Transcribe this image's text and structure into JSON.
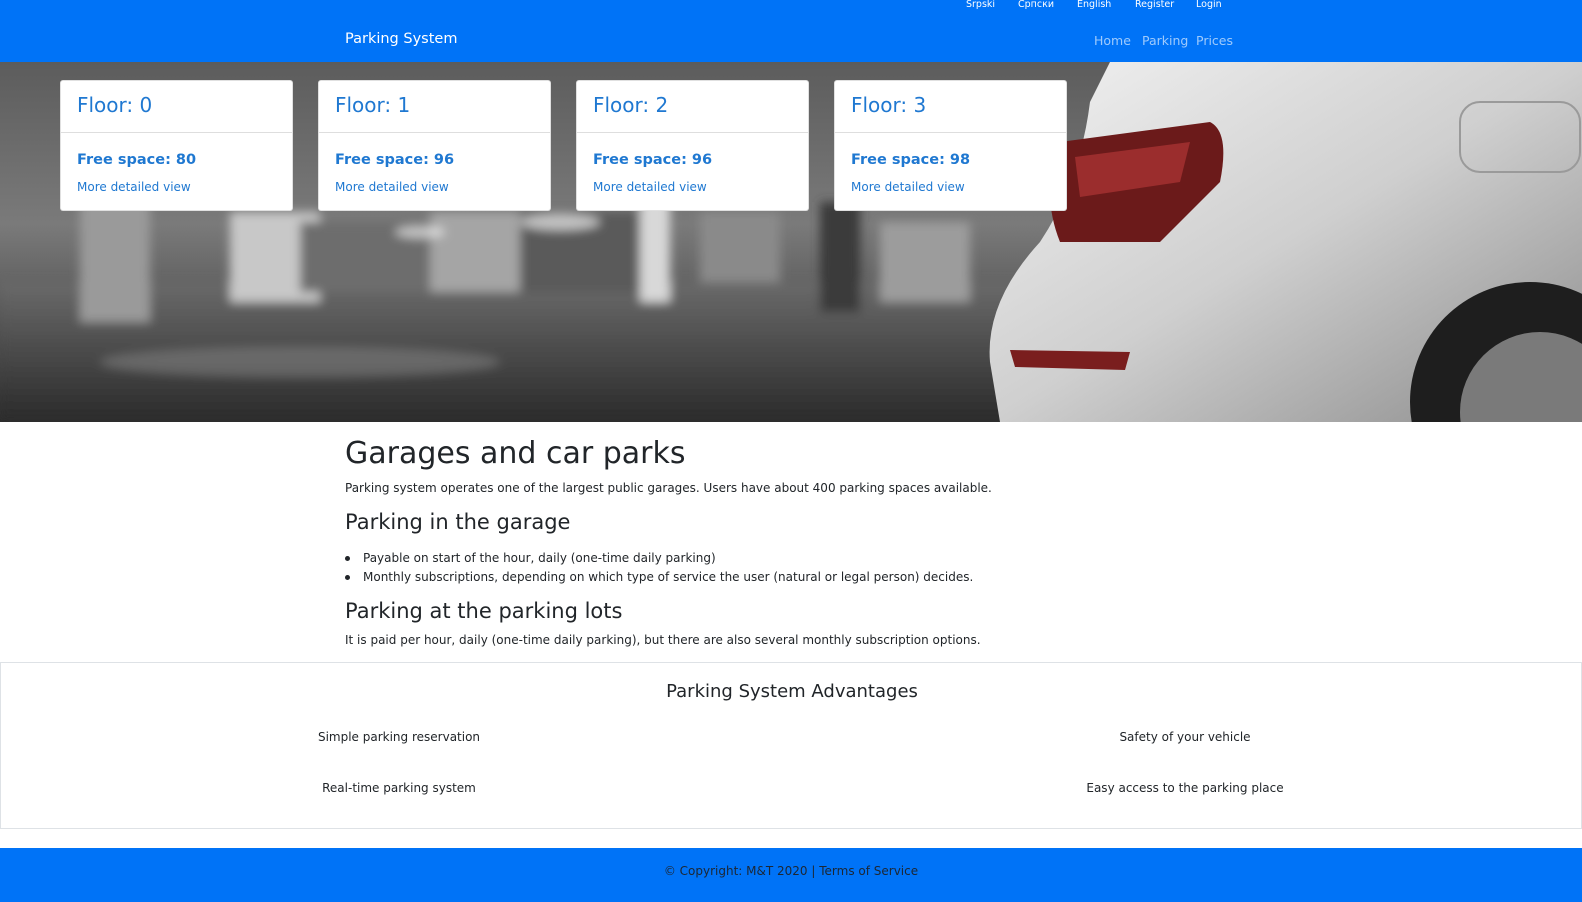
{
  "nav": {
    "languages": [
      "Srpski",
      "Српски",
      "English"
    ],
    "register": "Register",
    "login": "Login",
    "brand": "Parking System",
    "links": [
      "Home",
      "Parking",
      "Prices"
    ]
  },
  "floors": [
    {
      "title": "Floor: 0",
      "free": "Free space: 80",
      "link": "More detailed view"
    },
    {
      "title": "Floor: 1",
      "free": "Free space: 96",
      "link": "More detailed view"
    },
    {
      "title": "Floor: 2",
      "free": "Free space: 96",
      "link": "More detailed view"
    },
    {
      "title": "Floor: 3",
      "free": "Free space: 98",
      "link": "More detailed view"
    }
  ],
  "main": {
    "title": "Garages and car parks",
    "intro": "Parking system operates one of the largest public garages. Users have about 400 parking spaces available.",
    "garage_title": "Parking in the garage",
    "garage_items": [
      "Payable on start of the hour, daily (one-time daily parking)",
      "Monthly subscriptions, depending on which type of service the user (natural or legal person) decides."
    ],
    "lots_title": "Parking at the parking lots",
    "lots_text": "It is paid per hour, daily (one-time daily parking), but there are also several monthly subscription options."
  },
  "advantages": {
    "title": "Parking System Advantages",
    "items": [
      "Simple parking reservation",
      "Safety of your vehicle",
      "Real-time parking system",
      "Easy access to the parking place"
    ]
  },
  "footer": {
    "copyright": "© Copyright: M&T 2020 | ",
    "terms": "Terms of Service"
  },
  "colors": {
    "primary": "#0073f7",
    "link": "#1f78d1"
  }
}
